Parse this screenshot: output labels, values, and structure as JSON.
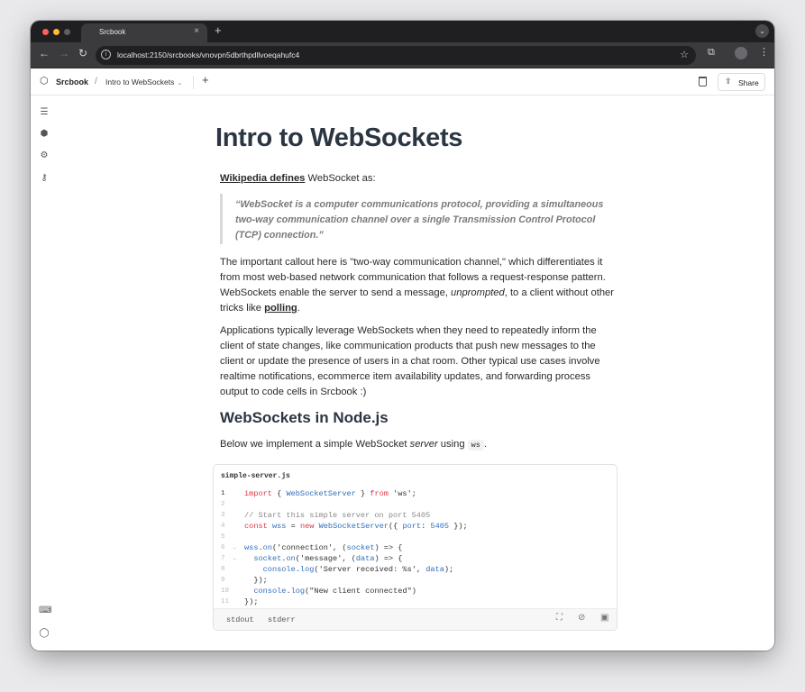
{
  "browser": {
    "tab_title": "Srcbook",
    "url": "localhost:2150/srcbooks/vnovpn5dbrthpdllvoeqahufc4"
  },
  "app": {
    "brand": "Srcbook",
    "breadcrumb_sep": "/",
    "doc_title": "Intro to WebSockets",
    "share_label": "Share"
  },
  "doc": {
    "title": "Intro to WebSockets",
    "p1_link": "Wikipedia defines",
    "p1_rest": " WebSocket as:",
    "quote": "“WebSocket is a computer communications protocol, providing a simultaneous two-way communication channel over a single Transmission Control Protocol (TCP) connection.”",
    "p2_a": "The important callout here is \"two-way communication channel,\" which differentiates it from most web-based network communication that follows a request-response pattern. WebSockets enable the server to send a message, ",
    "p2_em": "unprompted",
    "p2_b": ", to a client without other tricks like ",
    "p2_link": "polling",
    "p2_c": ".",
    "p3": "Applications typically leverage WebSockets when they need to repeatedly inform the client of state changes, like communication products that push new messages to the client or update the presence of users in a chat room. Other typical use cases involve realtime notifications, ecommerce item availability updates, and forwarding process output to code cells in Srcbook :)",
    "h2": "WebSockets in Node.js",
    "p4_a": "Below we implement a simple WebSocket ",
    "p4_em": "server",
    "p4_b": " using ",
    "p4_code": "ws",
    "p4_c": "."
  },
  "cell": {
    "filename": "simple-server.js",
    "output_tabs": [
      "stdout",
      "stderr"
    ],
    "line_numbers": [
      "1",
      "2",
      "3",
      "4",
      "5",
      "6",
      "7",
      "8",
      "9",
      "10",
      "11"
    ]
  }
}
